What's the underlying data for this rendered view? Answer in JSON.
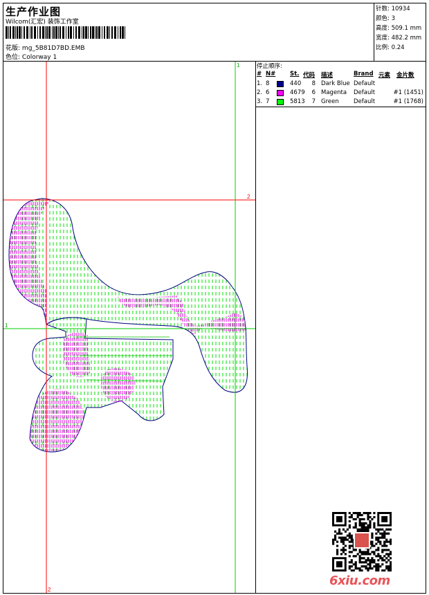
{
  "header": {
    "title": "生产作业图",
    "studio": "Wilcom(汇宏) 装饰工作室",
    "design_label": "花版:",
    "design_value": "mg_5B81D7BD.EMB",
    "color_label": "色位:",
    "color_value": "Colorway 1"
  },
  "stats": [
    {
      "label": "针数:",
      "value": "10934"
    },
    {
      "label": "颜色:",
      "value": "3"
    },
    {
      "label": "高度:",
      "value": "509.1 mm"
    },
    {
      "label": "宽度:",
      "value": "482.2 mm"
    },
    {
      "label": "比例:",
      "value": "0.24"
    }
  ],
  "stop_sequence": {
    "title": "停止顺序:",
    "columns": [
      "#",
      "N#",
      "St.",
      "代码",
      "描述",
      "Brand",
      "元素",
      "金片数"
    ],
    "rows": [
      {
        "num": "1.",
        "n": "8",
        "color": "#00008b",
        "st": "440",
        "code": "8",
        "desc": "Dark Blue",
        "brand": "Default",
        "element": "",
        "sequins": ""
      },
      {
        "num": "2.",
        "n": "6",
        "color": "#ff00ff",
        "st": "4679",
        "code": "6",
        "desc": "Magenta",
        "brand": "Default",
        "element": "",
        "sequins": "#1 (1451)"
      },
      {
        "num": "3.",
        "n": "7",
        "color": "#00ff00",
        "st": "5813",
        "code": "7",
        "desc": "Green",
        "brand": "Default",
        "element": "",
        "sequins": "#1 (1768)"
      }
    ]
  },
  "guides": {
    "h1_label": "1",
    "h2_label": "2",
    "v1_label": "1",
    "v2_label": "2",
    "v_green_color": "#00cc00",
    "v_red_color": "#ff0000"
  },
  "watermark": "6xiu.com",
  "colors": {
    "outline": "#000080",
    "fill_green": "#00e000",
    "fill_magenta": "#e000e0",
    "guide_red": "#ff0000",
    "guide_green": "#00cc00"
  }
}
